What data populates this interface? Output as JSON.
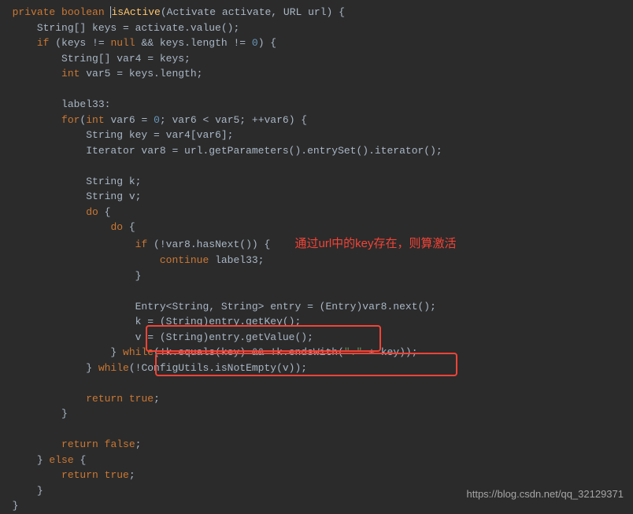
{
  "code": {
    "l1_private": "private",
    "l1_boolean": "boolean",
    "l1_method": "isActive",
    "l1_params": "(Activate activate, URL url) {",
    "l2": "    String[] keys = activate.value();",
    "l3_if": "if",
    "l3_cond": " (keys != ",
    "l3_null": "null",
    "l3_rest": " && keys.length != ",
    "l3_zero": "0",
    "l3_close": ") {",
    "l4": "        String[] var4 = keys;",
    "l5_int": "int",
    "l5_rest": " var5 = keys.length;",
    "l7": "        label33:",
    "l8_for": "for",
    "l8_open": "(",
    "l8_int": "int",
    "l8_init": " var6 = ",
    "l8_zero": "0",
    "l8_cond": "; var6 < var5; ++var6) {",
    "l9": "            String key = var4[var6];",
    "l10": "            Iterator var8 = url.getParameters().entrySet().iterator();",
    "l12": "            String k;",
    "l13": "            String v;",
    "l14_do": "do",
    "l14_brace": " {",
    "l15_do": "do",
    "l15_brace": " {",
    "l16_if": "if",
    "l16_cond": " (!var8.hasNext()) {",
    "l17_continue": "continue",
    "l17_label": " label33;",
    "l18": "                    }",
    "l20": "                    Entry<String, String> entry = (Entry)var8.next();",
    "l21": "                    k = (String)entry.getKey();",
    "l22": "                    v = (String)entry.getValue();",
    "l23_close": "                } ",
    "l23_while": "while",
    "l23_cond": "(!k.equals(key) && !k.endsWith(",
    "l23_str": "\".\"",
    "l23_rest": " + key));",
    "l24_close": "            } ",
    "l24_while": "while",
    "l24_cond": "(!ConfigUtils.isNotEmpty(v));",
    "l26_return": "return",
    "l26_true": "true",
    "l26_semi": ";",
    "l27": "        }",
    "l29_return": "return",
    "l29_false": "false",
    "l29_semi": ";",
    "l30_close": "    } ",
    "l30_else": "else",
    "l30_brace": " {",
    "l31_return": "return",
    "l31_true": "true",
    "l31_semi": ";",
    "l32": "    }",
    "l33": "}"
  },
  "annotation": "通过url中的key存在，则算激活",
  "watermark": "https://blog.csdn.net/qq_32129371"
}
